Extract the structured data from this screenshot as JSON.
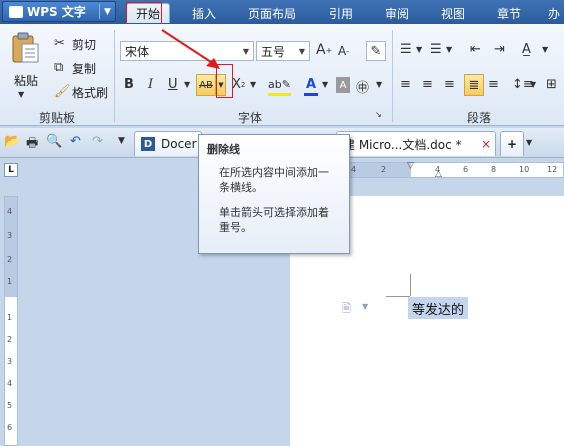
{
  "app": {
    "name": "WPS 文字"
  },
  "menu": {
    "tabs": [
      "开始",
      "插入",
      "页面布局",
      "引用",
      "审阅",
      "视图",
      "章节",
      "办"
    ],
    "active": "开始"
  },
  "ribbon": {
    "clipboard": {
      "paste": "粘贴",
      "cut": "剪切",
      "copy": "复制",
      "format_painter": "格式刷",
      "group_label": "剪贴板"
    },
    "font": {
      "font_name": "宋体",
      "font_size": "五号",
      "bold": "B",
      "italic": "I",
      "underline": "U",
      "strike": "AB",
      "superscript": "X",
      "font_color": "A",
      "group_label": "字体"
    },
    "paragraph": {
      "group_label": "段落"
    }
  },
  "doc_tabs": {
    "docer": "Docer",
    "active_doc": "建 Micro...文档.doc *",
    "close": "×",
    "add": "+"
  },
  "tooltip": {
    "title": "删除线",
    "line1": "在所选内容中间添加一",
    "line2": "条横线。",
    "line3": "单击箭头可选择添加着",
    "line4": "重号。"
  },
  "document": {
    "selected_text": "等发达的"
  },
  "colors": {
    "accent": "#2b5a9c",
    "highlight": "#c4d6ee",
    "annotation": "#e01b1b"
  }
}
